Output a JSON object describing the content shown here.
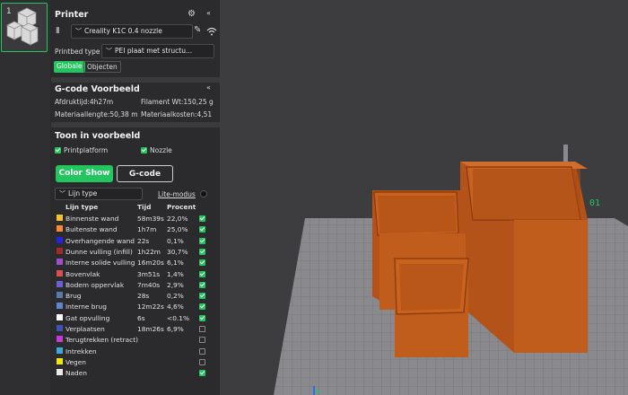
{
  "thumbnail": {
    "number": "1"
  },
  "printer": {
    "title": "Printer",
    "selected": "Creality K1C 0.4 nozzle",
    "bed_label": "Printbed type",
    "bed_value": "PEI plaat met structu...",
    "tabs": [
      "Globale",
      "Objecten"
    ]
  },
  "gcode": {
    "title": "G-code Voorbeeld",
    "print_time": "Afdruktijd:4h27m",
    "filament_weight": "Filament Wt:150,25 g",
    "material_length": "Materiaallengte:50,38 m",
    "material_cost": "Materiaalkosten:4,51"
  },
  "show": {
    "title": "Toon in voorbeeld",
    "printplatform": "Printplatform",
    "nozzle": "Nozzle",
    "color_show_label": "Color Show",
    "gcode_label": "G-code",
    "line_type_dropdown": "Lijn type",
    "lite_mode": "Lite-modus"
  },
  "table": {
    "headers": [
      "Lijn type",
      "Tijd",
      "Procent"
    ],
    "rows": [
      {
        "name": "Binnenste wand",
        "time": "58m39s",
        "pct": "22,0%",
        "color": "#f2c12e",
        "checked": true
      },
      {
        "name": "Buitenste wand",
        "time": "1h7m",
        "pct": "25,0%",
        "color": "#f58b3a",
        "checked": true
      },
      {
        "name": "Overhangende wand",
        "time": "22s",
        "pct": "0,1%",
        "color": "#2424e0",
        "checked": true
      },
      {
        "name": "Dunne vulling (infill)",
        "time": "1h22m",
        "pct": "30,7%",
        "color": "#9e2a2a",
        "checked": true
      },
      {
        "name": "Interne solide vulling",
        "time": "16m20s",
        "pct": "6,1%",
        "color": "#9a52c7",
        "checked": true
      },
      {
        "name": "Bovenvlak",
        "time": "3m51s",
        "pct": "1,4%",
        "color": "#d94f4f",
        "checked": true
      },
      {
        "name": "Bodem oppervlak",
        "time": "7m40s",
        "pct": "2,9%",
        "color": "#6b5fd6",
        "checked": true
      },
      {
        "name": "Brug",
        "time": "28s",
        "pct": "0,2%",
        "color": "#5a78a8",
        "checked": true
      },
      {
        "name": "Interne brug",
        "time": "12m22s",
        "pct": "4,6%",
        "color": "#5f86c9",
        "checked": true
      },
      {
        "name": "Gat opvulling",
        "time": "6s",
        "pct": "<0.1%",
        "color": "#ffffff",
        "checked": true
      },
      {
        "name": "Verplaatsen",
        "time": "18m26s",
        "pct": "6,9%",
        "color": "#3f51b5",
        "checked": false
      },
      {
        "name": "Terugtrekken (retract)",
        "time": "",
        "pct": "",
        "color": "#c23bd4",
        "checked": false
      },
      {
        "name": "Intrekken",
        "time": "",
        "pct": "",
        "color": "#3fa7d6",
        "checked": false
      },
      {
        "name": "Vegen",
        "time": "",
        "pct": "",
        "color": "#f2e600",
        "checked": false
      },
      {
        "name": "Naden",
        "time": "",
        "pct": "",
        "color": "#e8e8e8",
        "checked": true
      }
    ]
  },
  "viewport": {
    "plate_label": "01"
  },
  "colors": {
    "accent": "#22c55e",
    "model": "#c8621f",
    "panel": "#2b2b2e"
  }
}
